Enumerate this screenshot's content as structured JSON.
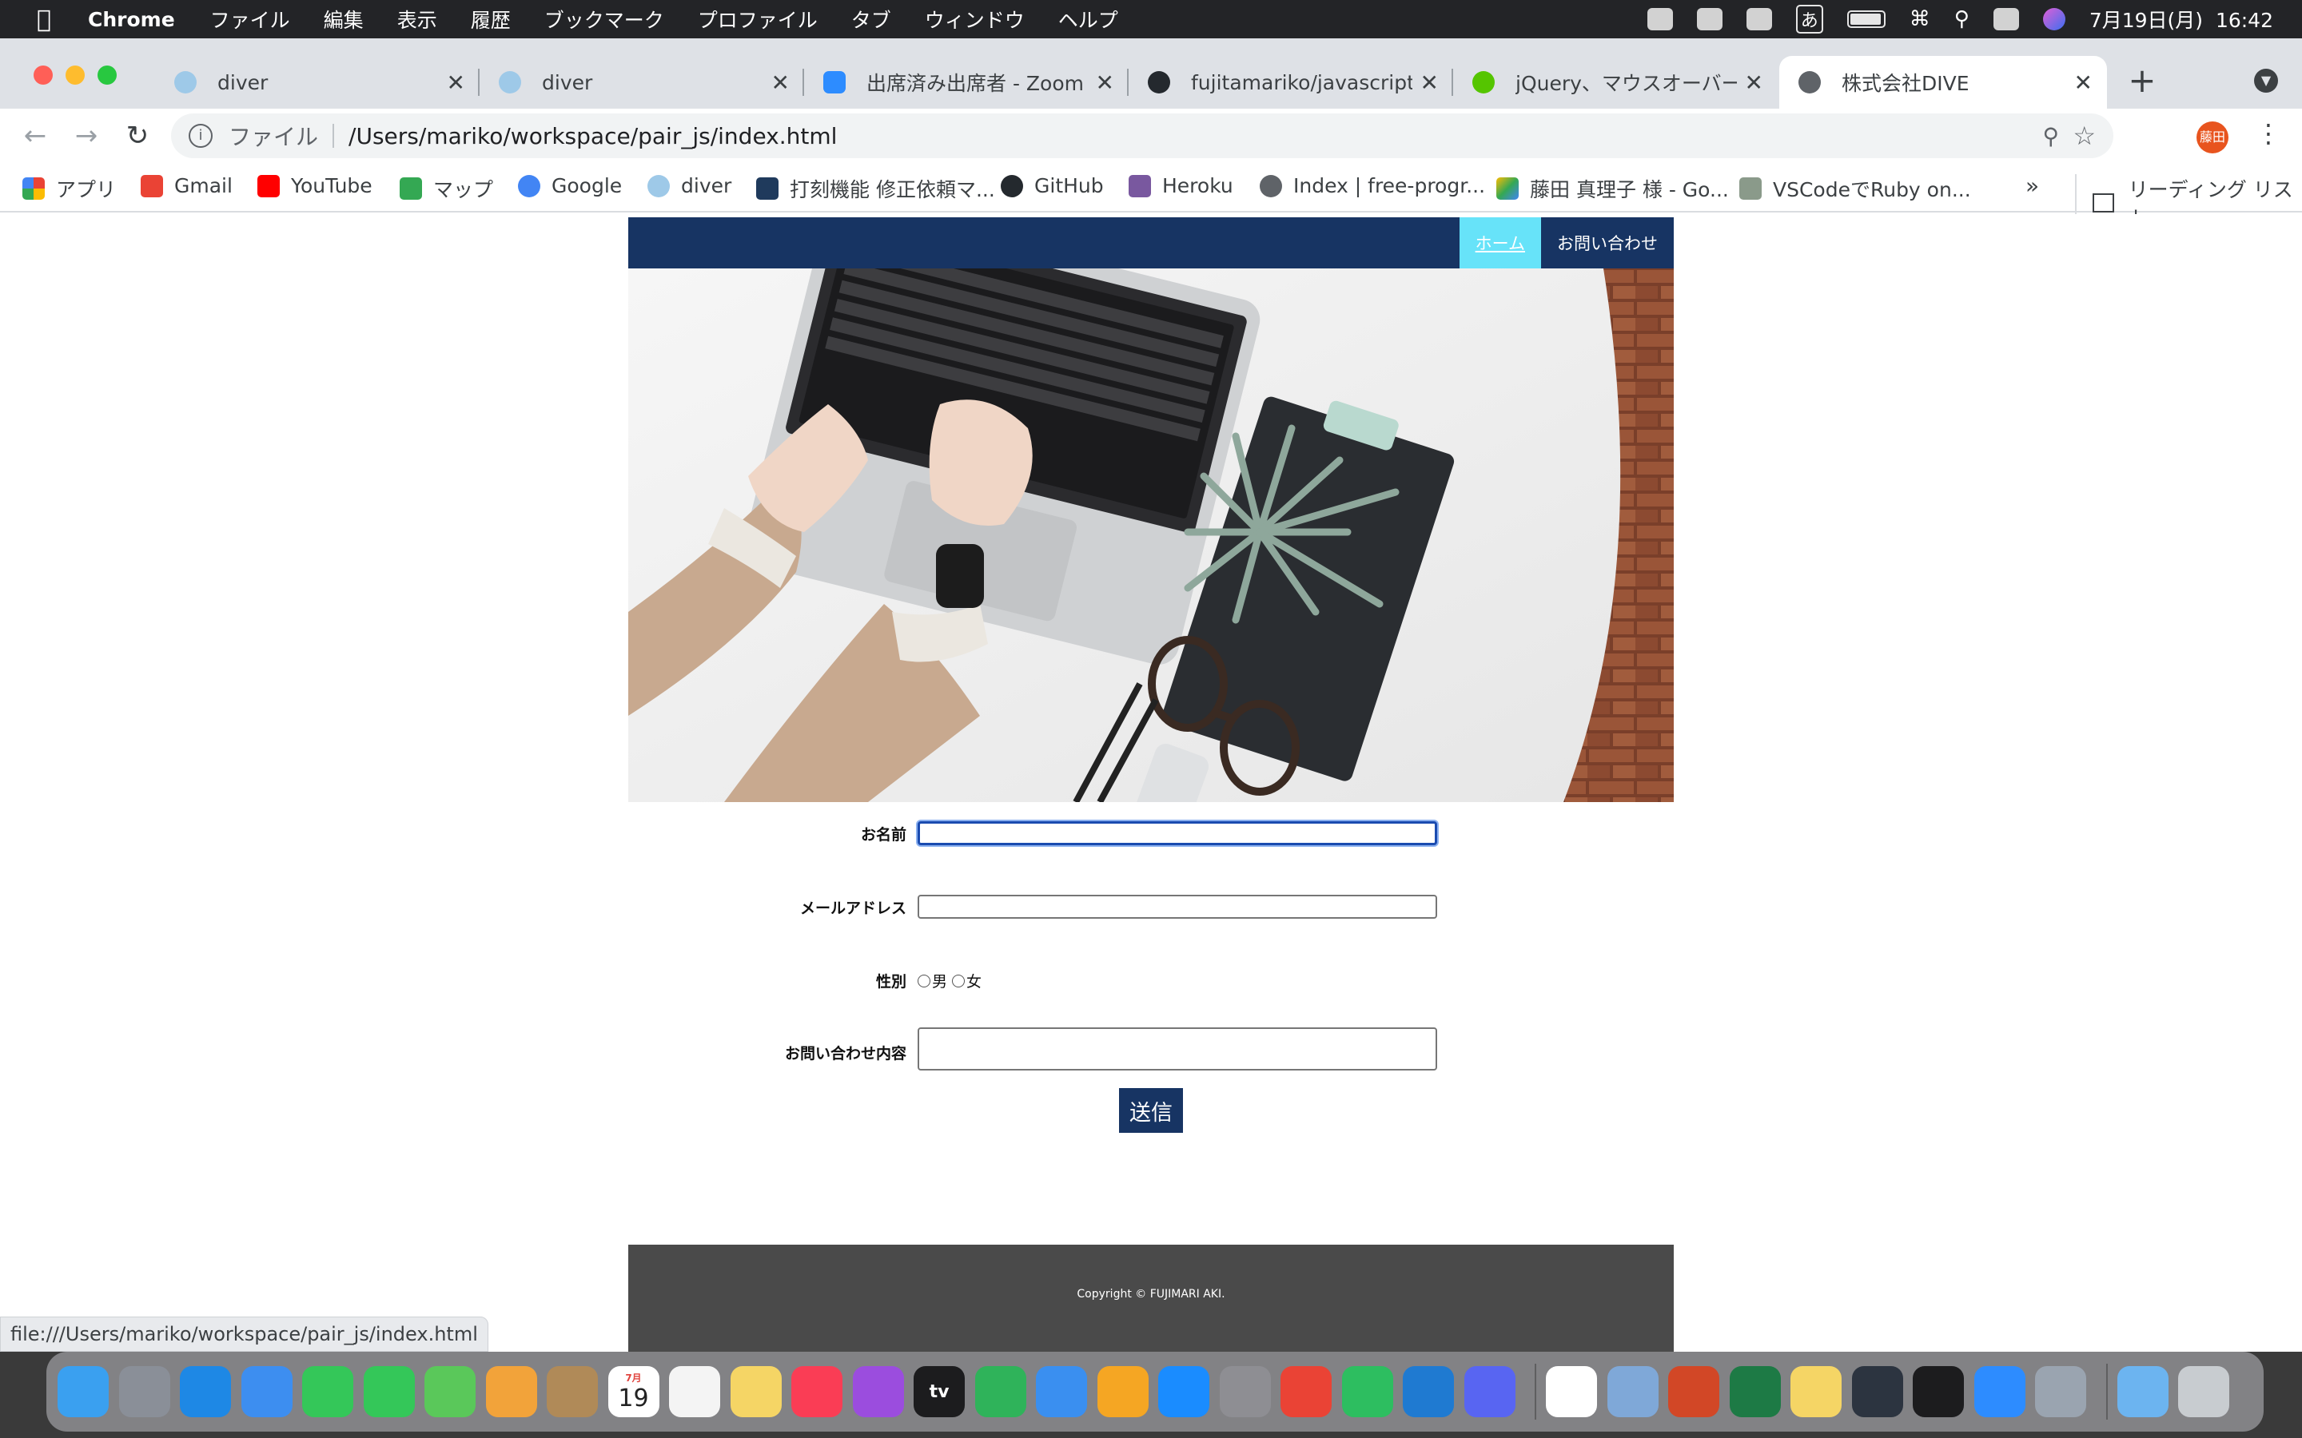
{
  "menubar": {
    "app_name": "Chrome",
    "items": [
      "ファイル",
      "編集",
      "表示",
      "履歴",
      "ブックマーク",
      "プロファイル",
      "タブ",
      "ウィンドウ",
      "ヘルプ"
    ],
    "clock": "7月19日(月)  16:42",
    "ime": "あ"
  },
  "tabs": [
    {
      "title": "diver",
      "favicon": "diver-icon",
      "color": "#9ec9e8"
    },
    {
      "title": "diver",
      "favicon": "diver-icon",
      "color": "#9ec9e8"
    },
    {
      "title": "出席済み出席者 - Zoom",
      "favicon": "zoom-icon",
      "color": "#2d8cff"
    },
    {
      "title": "fujitamariko/javascript_e",
      "favicon": "github-icon",
      "color": "#24292e"
    },
    {
      "title": "jQuery、マウスオーバーで",
      "favicon": "qiita-icon",
      "color": "#55c500"
    },
    {
      "title": "株式会社DIVE",
      "favicon": "globe-icon",
      "color": "#5f6368"
    }
  ],
  "toolbar": {
    "scheme": "ファイル",
    "url": "/Users/mariko/workspace/pair_js/index.html",
    "profile": "藤田"
  },
  "bookmarks": [
    {
      "label": "アプリ",
      "icon": "apps-grid-icon",
      "color": "#ea4335"
    },
    {
      "label": "Gmail",
      "icon": "gmail-icon",
      "color": "#ea4335"
    },
    {
      "label": "YouTube",
      "icon": "youtube-icon",
      "color": "#ff0000"
    },
    {
      "label": "マップ",
      "icon": "maps-icon",
      "color": "#34a853"
    },
    {
      "label": "Google",
      "icon": "google-icon",
      "color": "#4285f4"
    },
    {
      "label": "diver",
      "icon": "diver-icon",
      "color": "#9ec9e8"
    },
    {
      "label": "打刻機能 修正依頼マ...",
      "icon": "bookmark-icon",
      "color": "#1f3a5c"
    },
    {
      "label": "GitHub",
      "icon": "github-icon",
      "color": "#24292e"
    },
    {
      "label": "Heroku",
      "icon": "heroku-icon",
      "color": "#79589f"
    },
    {
      "label": "Index | free-progr...",
      "icon": "globe-icon",
      "color": "#5f6368"
    },
    {
      "label": "藤田 真理子 様 - Go...",
      "icon": "google-drive-icon",
      "color": "#fbbc04"
    },
    {
      "label": "VSCodeでRuby on...",
      "icon": "page-icon",
      "color": "#8a9a8a"
    }
  ],
  "reading_list": "リーディング リスト",
  "site": {
    "nav": [
      "ホーム",
      "お問い合わせ"
    ],
    "hero_alt": "laptop-desk-photo",
    "form": {
      "name_label": "お名前",
      "email_label": "メールアドレス",
      "gender_label": "性別",
      "gender_options": [
        "男",
        "女"
      ],
      "message_label": "お問い合わせ内容",
      "submit": "送信"
    },
    "copyright": "Copyright © FUJIMARI AKI."
  },
  "status_url": "file:///Users/mariko/workspace/pair_js/index.html",
  "dock": {
    "apps": [
      {
        "name": "finder-icon",
        "color": "#3aa0f0"
      },
      {
        "name": "launchpad-icon",
        "color": "#8a8f98"
      },
      {
        "name": "safari-icon",
        "color": "#1e88e5"
      },
      {
        "name": "mail-icon",
        "color": "#3d8ef0"
      },
      {
        "name": "facetime-icon",
        "color": "#34c759"
      },
      {
        "name": "messages-icon",
        "color": "#34c759"
      },
      {
        "name": "maps-icon",
        "color": "#5ac85a"
      },
      {
        "name": "photos-icon",
        "color": "#f2a33a"
      },
      {
        "name": "contacts-icon",
        "color": "#b08a58"
      },
      {
        "name": "calendar-icon",
        "color": "#ffffff"
      },
      {
        "name": "reminders-icon",
        "color": "#f4f4f4"
      },
      {
        "name": "notes-icon",
        "color": "#f5d565"
      },
      {
        "name": "music-icon",
        "color": "#fa3d55"
      },
      {
        "name": "podcasts-icon",
        "color": "#9b4dde"
      },
      {
        "name": "tv-icon",
        "color": "#1c1c1e"
      },
      {
        "name": "numbers-icon",
        "color": "#2fb35a"
      },
      {
        "name": "keynote-icon",
        "color": "#3a8ff0"
      },
      {
        "name": "pages-icon",
        "color": "#f5a623"
      },
      {
        "name": "app-store-icon",
        "color": "#1a8cff"
      },
      {
        "name": "system-preferences-icon",
        "color": "#8e8e93"
      },
      {
        "name": "chrome-icon",
        "color": "#ea4335"
      },
      {
        "name": "evernote-icon",
        "color": "#2dbe60"
      },
      {
        "name": "vscode-icon",
        "color": "#1f7ad1"
      },
      {
        "name": "discord-icon",
        "color": "#5865f2"
      },
      {
        "name": "slack-icon",
        "color": "#ffffff"
      },
      {
        "name": "preview-icon",
        "color": "#7fa8d8"
      },
      {
        "name": "powerpoint-icon",
        "color": "#d24726"
      },
      {
        "name": "excel-icon",
        "color": "#1d7a45"
      },
      {
        "name": "stickies-icon",
        "color": "#f5d565"
      },
      {
        "name": "vpn-shield-icon",
        "color": "#2c3440"
      },
      {
        "name": "terminal-icon",
        "color": "#1c1c1e"
      },
      {
        "name": "zoom-icon",
        "color": "#2d8cff"
      },
      {
        "name": "screenshot-icon",
        "color": "#9aa4b0"
      },
      {
        "name": "downloads-folder-icon",
        "color": "#6cb4f0"
      },
      {
        "name": "trash-icon",
        "color": "#c8ccd0"
      }
    ],
    "calendar_month": "7月",
    "calendar_day": "19",
    "tv_label": "tv"
  },
  "colors": {
    "site_primary": "#173463",
    "nav_active": "#67e3f9",
    "footer": "#4a4a4a"
  }
}
